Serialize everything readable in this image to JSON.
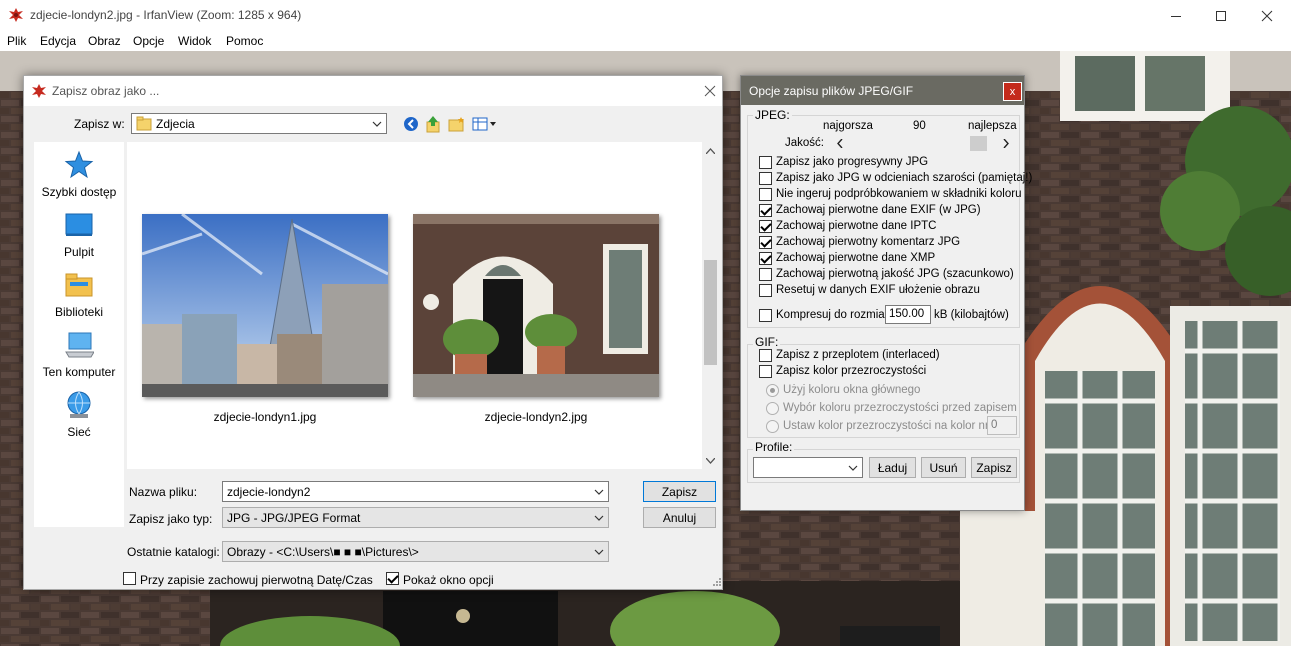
{
  "window": {
    "title": "zdjecie-londyn2.jpg - IrfanView (Zoom: 1285 x 964)",
    "menu": [
      "Plik",
      "Edycja",
      "Obraz",
      "Opcje",
      "Widok",
      "Pomoc"
    ]
  },
  "save_dialog": {
    "title": "Zapisz obraz jako ...",
    "save_in_label": "Zapisz w:",
    "save_in_value": "Zdjecia",
    "places": [
      "Szybki dostęp",
      "Pulpit",
      "Biblioteki",
      "Ten komputer",
      "Sieć"
    ],
    "files": [
      "zdjecie-londyn1.jpg",
      "zdjecie-londyn2.jpg"
    ],
    "filename_label": "Nazwa pliku:",
    "filename_value": "zdjecie-londyn2",
    "filetype_label": "Zapisz jako typ:",
    "filetype_value": "JPG - JPG/JPEG Format",
    "recent_label": "Ostatnie katalogi:",
    "recent_value": "Obrazy  -  <C:\\Users\\■ ■ ■\\Pictures\\>",
    "save_button": "Zapisz",
    "cancel_button": "Anuluj",
    "keep_date_label": "Przy zapisie zachowuj pierwotną Datę/Czas",
    "keep_date_checked": false,
    "show_options_label": "Pokaż okno opcji",
    "show_options_checked": true
  },
  "options_panel": {
    "title": "Opcje zapisu plików JPEG/GIF",
    "close_glyph": "x",
    "jpeg_group": "JPEG:",
    "worst": "najgorsza",
    "best": "najlepsza",
    "quality_value": "90",
    "quality_fraction": 0.9,
    "quality_label": "Jakość:",
    "jpeg_options": [
      {
        "label": "Zapisz jako progresywny JPG",
        "checked": false
      },
      {
        "label": "Zapisz jako JPG w odcieniach szarości  (pamiętaj!)",
        "checked": false
      },
      {
        "label": "Nie ingeruj podpróbkowaniem w składniki koloru",
        "checked": false
      },
      {
        "label": "Zachowaj pierwotne dane EXIF (w JPG)",
        "checked": true
      },
      {
        "label": "Zachowaj pierwotne dane IPTC",
        "checked": true
      },
      {
        "label": "Zachowaj pierwotny komentarz JPG",
        "checked": true
      },
      {
        "label": "Zachowaj pierwotne dane XMP",
        "checked": true
      },
      {
        "label": "Zachowaj pierwotną jakość JPG  (szacunkowo)",
        "checked": false
      },
      {
        "label": "Resetuj w danych EXIF ułożenie obrazu",
        "checked": false
      }
    ],
    "compress_label": "Kompresuj do rozmiaru:",
    "compress_value": "150.00",
    "compress_unit": "kB (kilobajtów)",
    "compress_checked": false,
    "gif_group": "GIF:",
    "gif_options": [
      {
        "label": "Zapisz z przeplotem (interlaced)",
        "checked": false
      },
      {
        "label": "Zapisz kolor przezroczystości",
        "checked": false
      }
    ],
    "gif_radios": [
      {
        "label": "Użyj koloru okna głównego",
        "selected": true
      },
      {
        "label": "Wybór koloru przezroczystości przed zapisem",
        "selected": false
      },
      {
        "label": "Ustaw kolor przezroczystości na kolor nr :",
        "selected": false
      }
    ],
    "color_index": "0",
    "profile_label": "Profile:",
    "load_button": "Ładuj",
    "delete_button": "Usuń",
    "save_profile_button": "Zapisz"
  }
}
